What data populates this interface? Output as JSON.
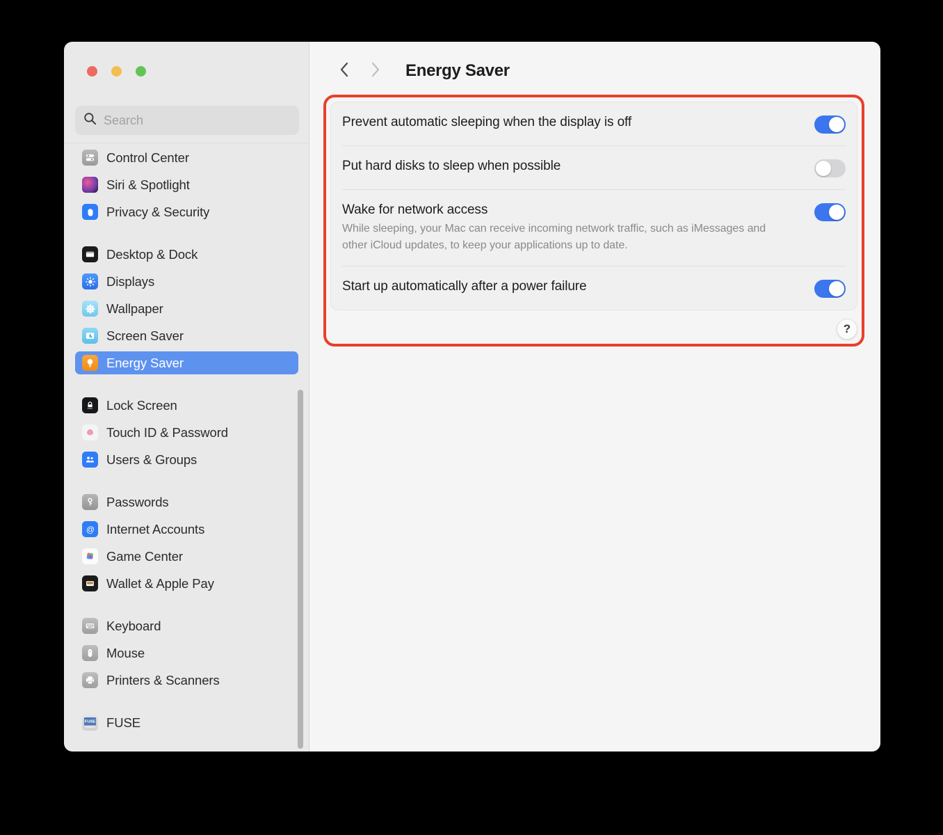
{
  "window": {
    "traffic_lights": [
      {
        "name": "close",
        "color": "#EC6A5F"
      },
      {
        "name": "minimize",
        "color": "#F4BD4F"
      },
      {
        "name": "maximize",
        "color": "#61C555"
      }
    ]
  },
  "sidebar": {
    "search": {
      "placeholder": "Search",
      "value": "",
      "icon": "search-icon"
    },
    "groups": [
      {
        "items": [
          {
            "label": "Control Center",
            "icon": "control-center-icon",
            "selected": false
          },
          {
            "label": "Siri & Spotlight",
            "icon": "siri-icon",
            "selected": false
          },
          {
            "label": "Privacy & Security",
            "icon": "privacy-hand-icon",
            "selected": false
          }
        ]
      },
      {
        "items": [
          {
            "label": "Desktop & Dock",
            "icon": "desktop-dock-icon",
            "selected": false
          },
          {
            "label": "Displays",
            "icon": "displays-brightness-icon",
            "selected": false
          },
          {
            "label": "Wallpaper",
            "icon": "wallpaper-flower-icon",
            "selected": false
          },
          {
            "label": "Screen Saver",
            "icon": "screen-saver-icon",
            "selected": false
          },
          {
            "label": "Energy Saver",
            "icon": "energy-saver-bulb-icon",
            "selected": true
          }
        ]
      },
      {
        "items": [
          {
            "label": "Lock Screen",
            "icon": "lock-screen-icon",
            "selected": false
          },
          {
            "label": "Touch ID & Password",
            "icon": "touch-id-fingerprint-icon",
            "selected": false
          },
          {
            "label": "Users & Groups",
            "icon": "users-groups-icon",
            "selected": false
          }
        ]
      },
      {
        "items": [
          {
            "label": "Passwords",
            "icon": "passwords-key-icon",
            "selected": false
          },
          {
            "label": "Internet Accounts",
            "icon": "internet-accounts-at-icon",
            "selected": false
          },
          {
            "label": "Game Center",
            "icon": "game-center-icon",
            "selected": false
          },
          {
            "label": "Wallet & Apple Pay",
            "icon": "wallet-icon",
            "selected": false
          }
        ]
      },
      {
        "items": [
          {
            "label": "Keyboard",
            "icon": "keyboard-icon",
            "selected": false
          },
          {
            "label": "Mouse",
            "icon": "mouse-icon",
            "selected": false
          },
          {
            "label": "Printers & Scanners",
            "icon": "printer-icon",
            "selected": false
          }
        ]
      },
      {
        "items": [
          {
            "label": "FUSE",
            "icon": "fuse-icon",
            "selected": false
          }
        ]
      }
    ],
    "scrollbar": {
      "name": "sidebar-scrollbar"
    }
  },
  "toolbar": {
    "back_icon": "chevron-left-icon",
    "forward_icon": "chevron-right-icon",
    "title": "Energy Saver"
  },
  "highlight": {
    "color": "#E8402A"
  },
  "settings": {
    "rows": [
      {
        "title": "Prevent automatic sleeping when the display is off",
        "description": "",
        "toggle_state": "on"
      },
      {
        "title": "Put hard disks to sleep when possible",
        "description": "",
        "toggle_state": "off"
      },
      {
        "title": "Wake for network access",
        "description": "While sleeping, your Mac can receive incoming network traffic, such as iMessages and other iCloud updates, to keep your applications up to date.",
        "toggle_state": "on"
      },
      {
        "title": "Start up automatically after a power failure",
        "description": "",
        "toggle_state": "on"
      }
    ],
    "help_label": "?"
  },
  "colors": {
    "toggle_on": "#3B76EE",
    "toggle_off": "#D5D5D7",
    "selection": "#5E92EF",
    "highlight_border": "#E8402A"
  }
}
